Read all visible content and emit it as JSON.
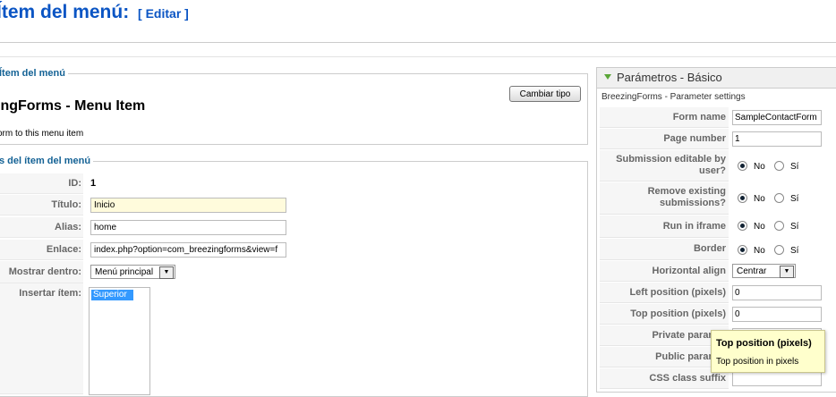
{
  "header": {
    "title": "Ítem del menú:",
    "edit_link": "[ Editar ]"
  },
  "menu_type": {
    "legend": "Ítem del menú",
    "change_button": "Cambiar tipo",
    "title": "BreezingForms - Menu Item",
    "description": "Form to this menu item",
    "title_visible": "ingForms - Menu Item",
    "description_visible": "orm to this menu item"
  },
  "details": {
    "legend": "s del ítem del menú",
    "id_label": "ID:",
    "id_value": "1",
    "title_label": "Título:",
    "title_value": "Inicio",
    "alias_label": "Alias:",
    "alias_value": "home",
    "link_label": "Enlace:",
    "link_value": "index.php?option=com_breezingforms&view=f",
    "display_in_label": "Mostrar dentro:",
    "display_in_value": "Menú principal",
    "insert_label": "Insertar ítem:",
    "insert_options": [
      "Superior"
    ]
  },
  "params": {
    "header": "Parámetros - Básico",
    "subtitle": "BreezingForms - Parameter settings",
    "form_name_label": "Form name",
    "form_name_value": "SampleContactForm",
    "page_number_label": "Page number",
    "page_number_value": "1",
    "submission_editable_label": "Submission editable by user?",
    "remove_existing_label": "Remove existing submissions?",
    "run_iframe_label": "Run in iframe",
    "border_label": "Border",
    "no_label": "No",
    "yes_label": "Sí",
    "horizontal_align_label": "Horizontal align",
    "horizontal_align_value": "Centrar",
    "left_position_label": "Left position (pixels)",
    "left_position_value": "0",
    "top_position_label": "Top position (pixels)",
    "top_position_value": "0",
    "private_params_label": "Private paramet",
    "public_params_label": "Public paramet",
    "css_suffix_label": "CSS class suffix"
  },
  "tooltip": {
    "title": "Top position (pixels)",
    "body": "Top position in pixels"
  }
}
